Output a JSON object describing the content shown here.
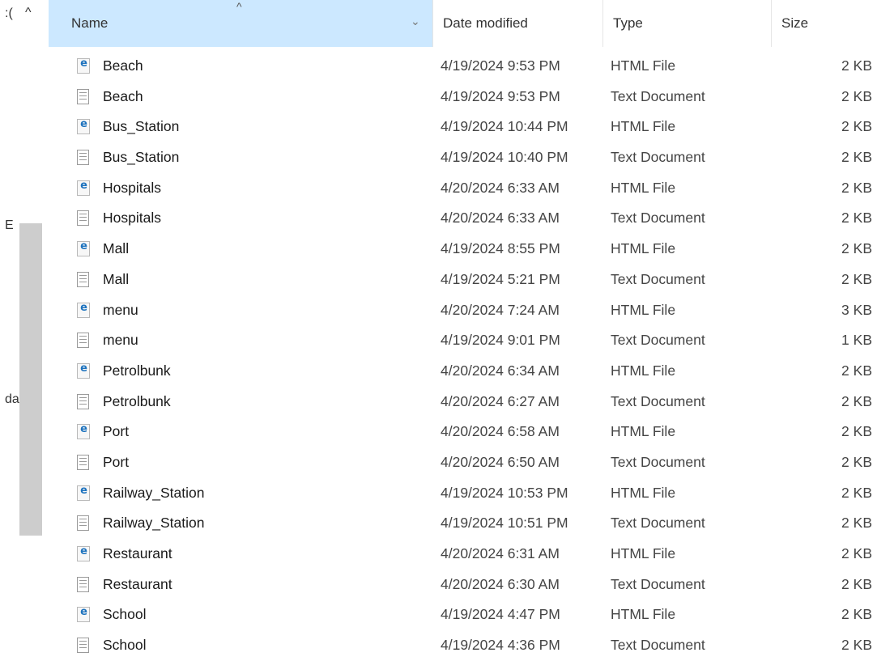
{
  "nav": {
    "fragments": [
      ":(",
      "E",
      "da"
    ]
  },
  "columns": {
    "name": "Name",
    "date": "Date modified",
    "type": "Type",
    "size": "Size"
  },
  "files": [
    {
      "name": "Beach",
      "date": "4/19/2024 9:53 PM",
      "type": "HTML File",
      "size": "2 KB",
      "icon": "html-file-icon"
    },
    {
      "name": "Beach",
      "date": "4/19/2024 9:53 PM",
      "type": "Text Document",
      "size": "2 KB",
      "icon": "text-file-icon"
    },
    {
      "name": "Bus_Station",
      "date": "4/19/2024 10:44 PM",
      "type": "HTML File",
      "size": "2 KB",
      "icon": "html-file-icon"
    },
    {
      "name": "Bus_Station",
      "date": "4/19/2024 10:40 PM",
      "type": "Text Document",
      "size": "2 KB",
      "icon": "text-file-icon"
    },
    {
      "name": "Hospitals",
      "date": "4/20/2024 6:33 AM",
      "type": "HTML File",
      "size": "2 KB",
      "icon": "html-file-icon"
    },
    {
      "name": "Hospitals",
      "date": "4/20/2024 6:33 AM",
      "type": "Text Document",
      "size": "2 KB",
      "icon": "text-file-icon"
    },
    {
      "name": "Mall",
      "date": "4/19/2024 8:55 PM",
      "type": "HTML File",
      "size": "2 KB",
      "icon": "html-file-icon"
    },
    {
      "name": "Mall",
      "date": "4/19/2024 5:21 PM",
      "type": "Text Document",
      "size": "2 KB",
      "icon": "text-file-icon"
    },
    {
      "name": "menu",
      "date": "4/20/2024 7:24 AM",
      "type": "HTML File",
      "size": "3 KB",
      "icon": "html-file-icon"
    },
    {
      "name": "menu",
      "date": "4/19/2024 9:01 PM",
      "type": "Text Document",
      "size": "1 KB",
      "icon": "text-file-icon"
    },
    {
      "name": "Petrolbunk",
      "date": "4/20/2024 6:34 AM",
      "type": "HTML File",
      "size": "2 KB",
      "icon": "html-file-icon"
    },
    {
      "name": "Petrolbunk",
      "date": "4/20/2024 6:27 AM",
      "type": "Text Document",
      "size": "2 KB",
      "icon": "text-file-icon"
    },
    {
      "name": "Port",
      "date": "4/20/2024 6:58 AM",
      "type": "HTML File",
      "size": "2 KB",
      "icon": "html-file-icon"
    },
    {
      "name": "Port",
      "date": "4/20/2024 6:50 AM",
      "type": "Text Document",
      "size": "2 KB",
      "icon": "text-file-icon"
    },
    {
      "name": "Railway_Station",
      "date": "4/19/2024 10:53 PM",
      "type": "HTML File",
      "size": "2 KB",
      "icon": "html-file-icon"
    },
    {
      "name": "Railway_Station",
      "date": "4/19/2024 10:51 PM",
      "type": "Text Document",
      "size": "2 KB",
      "icon": "text-file-icon"
    },
    {
      "name": "Restaurant",
      "date": "4/20/2024 6:31 AM",
      "type": "HTML File",
      "size": "2 KB",
      "icon": "html-file-icon"
    },
    {
      "name": "Restaurant",
      "date": "4/20/2024 6:30 AM",
      "type": "Text Document",
      "size": "2 KB",
      "icon": "text-file-icon"
    },
    {
      "name": "School",
      "date": "4/19/2024 4:47 PM",
      "type": "HTML File",
      "size": "2 KB",
      "icon": "html-file-icon"
    },
    {
      "name": "School",
      "date": "4/19/2024 4:36 PM",
      "type": "Text Document",
      "size": "2 KB",
      "icon": "text-file-icon"
    }
  ],
  "colors": {
    "header_sorted_bg": "#cce8ff",
    "scrollbar_thumb": "#cdcdcd",
    "html_icon_accent": "#1e73be"
  }
}
